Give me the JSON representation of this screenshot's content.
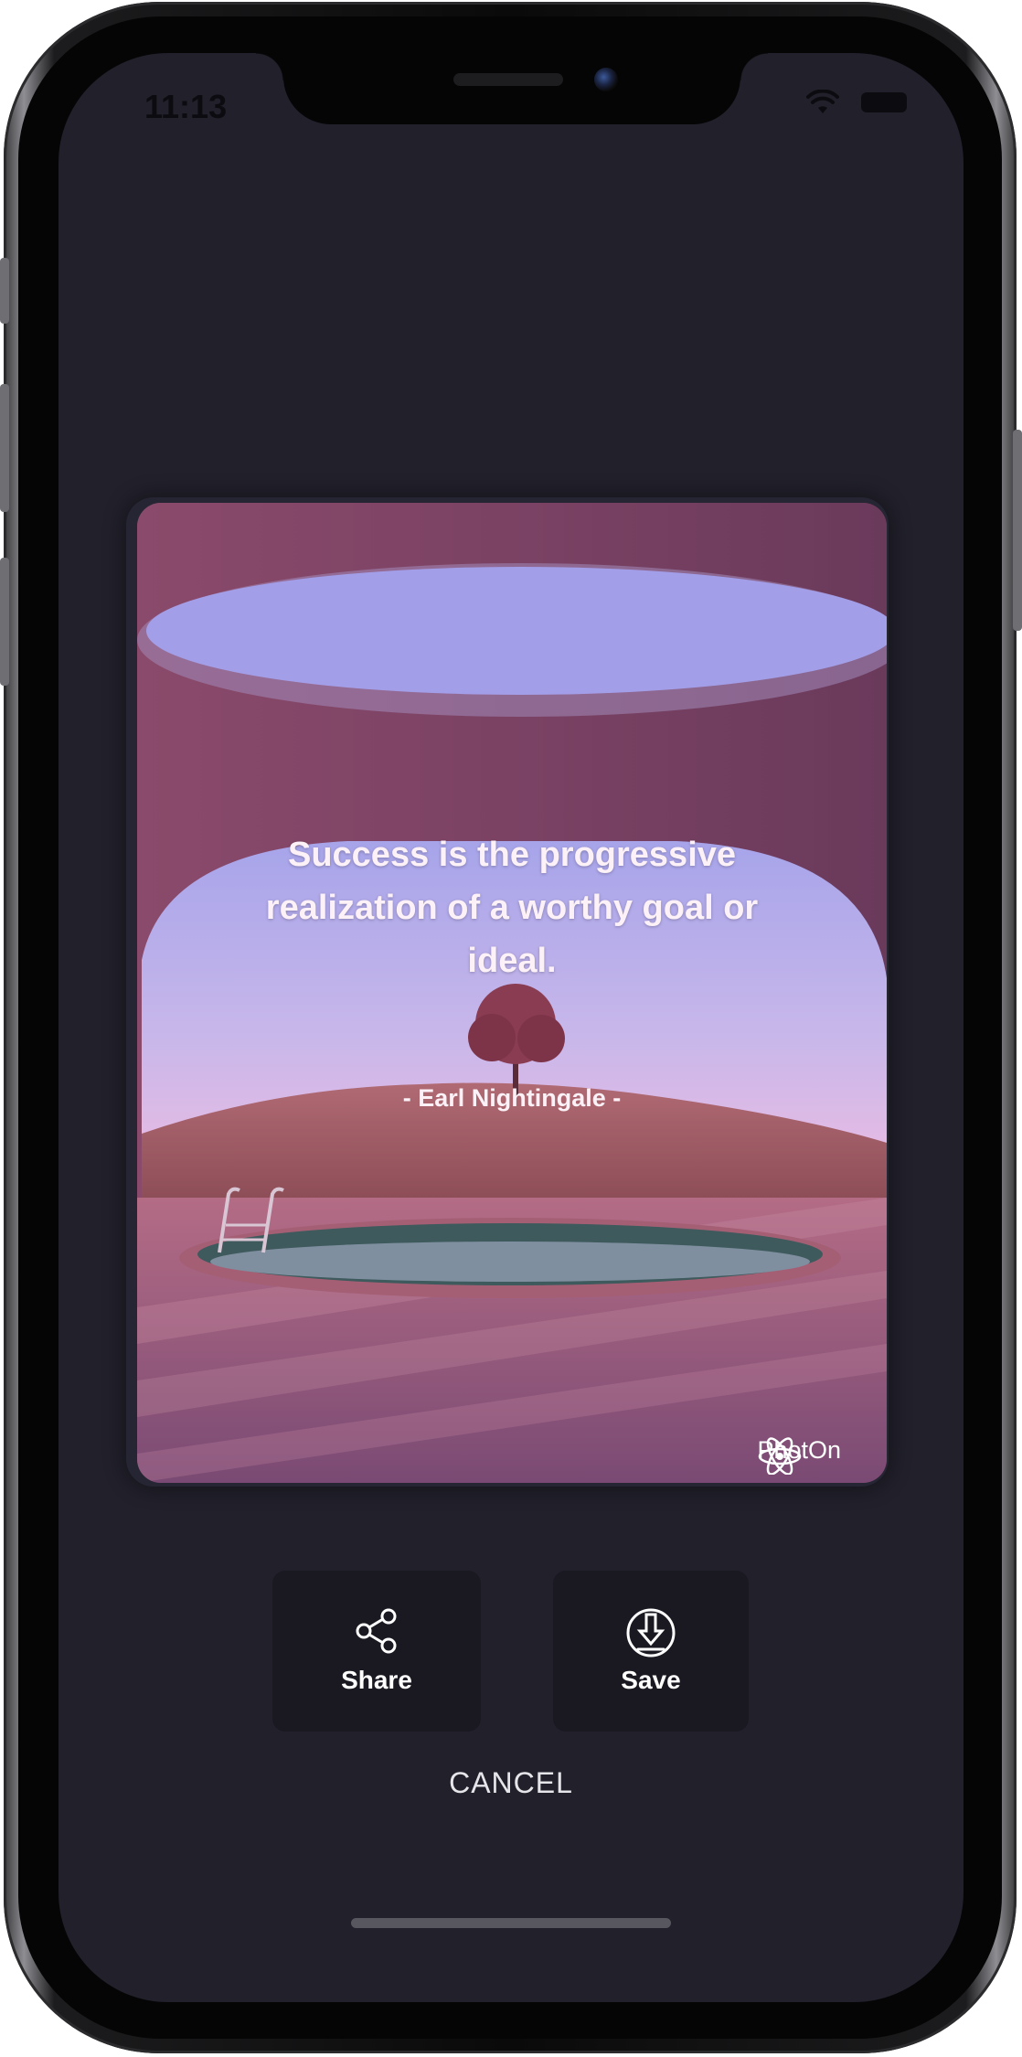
{
  "status_bar": {
    "time": "11:13",
    "icons": [
      "wifi-icon",
      "battery-icon"
    ]
  },
  "card": {
    "quote": "Success is the progressive realization of a worthy goal or ideal.",
    "author": "- Earl Nightingale -",
    "watermark": "PhotOn",
    "watermark_icon": "photon-logo-icon"
  },
  "actions": {
    "share_label": "Share",
    "share_icon": "share-icon",
    "save_label": "Save",
    "save_icon": "download-icon",
    "cancel_label": "CANCEL"
  },
  "colors": {
    "background": "#21202b",
    "button": "#1a1922",
    "card": "#773e5f"
  }
}
